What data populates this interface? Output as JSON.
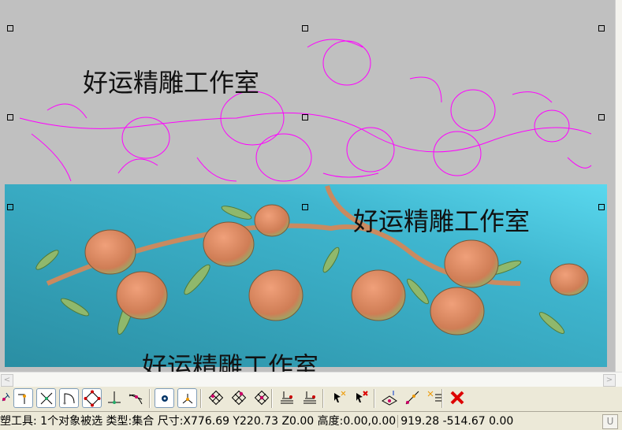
{
  "watermark": "好运精雕工作室",
  "colors": {
    "canvas": "#c0c0c0",
    "relief": "#35a8c0",
    "vector": "#ff00ff",
    "peach": "#d98a5e"
  },
  "scroll": {
    "left": "<",
    "right": ">"
  },
  "toolbar": {
    "icons": [
      "node-edit-icon",
      "corner-icon",
      "intersect-icon",
      "arc-icon",
      "circle-points-icon",
      "perpendicular-icon",
      "tangent-icon",
      "center-point-icon",
      "axis-point-icon",
      "grid-point-1-icon",
      "grid-point-2-icon",
      "grid-point-3-icon",
      "layer-down-icon",
      "layer-up-icon",
      "select-point-icon",
      "deselect-point-icon",
      "surface-point-icon",
      "line-point-icon",
      "list-point-icon",
      "delete-icon"
    ]
  },
  "status": {
    "tool": "塑工具:",
    "selection": "1个对象被选",
    "type": "类型:集合",
    "size": "尺寸:X776.69 Y220.73 Z0.00",
    "height": "高度:0.00,0.00",
    "coords": "919.28 -514.67 0.00",
    "mode": "U"
  }
}
